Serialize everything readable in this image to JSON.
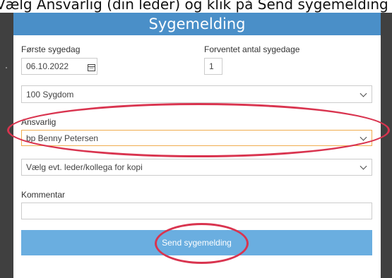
{
  "caption": "Vælg Ansvarlig (din leder) og klik på Send sygemelding",
  "dialog": {
    "title": "Sygemelding",
    "first_day_label": "Første sygedag",
    "first_day_value": "06.10.2022",
    "expected_days_label": "Forventet antal sygedage",
    "expected_days_value": "1",
    "reason_value": "100 Sygdom",
    "responsible_label": "Ansvarlig",
    "responsible_value": "bp Benny Petersen",
    "copy_placeholder": "Vælg evt. leder/kollega for kopi",
    "comment_label": "Kommentar",
    "comment_value": "",
    "send_label": "Send sygemelding"
  },
  "colors": {
    "header": "#4a8fc8",
    "button": "#6aaee0",
    "annotation": "#d9344f"
  }
}
